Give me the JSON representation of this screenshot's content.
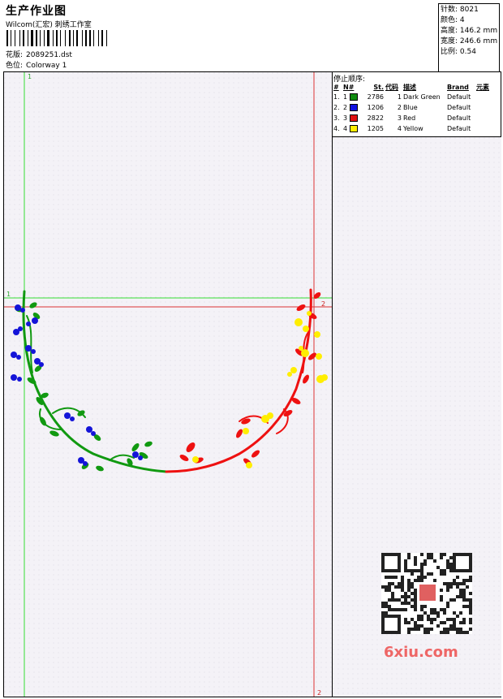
{
  "header": {
    "title": "生产作业图",
    "company": "Wilcom(汇宏) 刺绣工作室",
    "design_label": "花版:",
    "design_value": "2089251.dst",
    "colorway_label": "色位:",
    "colorway_value": "Colorway 1"
  },
  "stats": [
    {
      "label": "针数:",
      "value": "8021"
    },
    {
      "label": "颜色:",
      "value": "4"
    },
    {
      "label": "高度:",
      "value": "146.2 mm"
    },
    {
      "label": "宽度:",
      "value": "246.6 mm"
    },
    {
      "label": "比例:",
      "value": "0.54"
    }
  ],
  "stop_sequence": {
    "title": "停止顺序:",
    "headers": [
      "#",
      "N#",
      "St.",
      "代码",
      "描述",
      "Brand",
      "元素"
    ],
    "rows": [
      {
        "idx": "1.",
        "n": "1",
        "color": "#108c10",
        "st": "2786",
        "code": "1",
        "desc": "Dark Green",
        "brand": "Default"
      },
      {
        "idx": "2.",
        "n": "2",
        "color": "#1010e0",
        "st": "1206",
        "code": "2",
        "desc": "Blue",
        "brand": "Default"
      },
      {
        "idx": "3.",
        "n": "3",
        "color": "#e01010",
        "st": "2822",
        "code": "3",
        "desc": "Red",
        "brand": "Default"
      },
      {
        "idx": "4.",
        "n": "4",
        "color": "#ffee00",
        "st": "1205",
        "code": "4",
        "desc": "Yellow",
        "brand": "Default"
      }
    ]
  },
  "guides": {
    "green_label_v": "1",
    "green_label_h": "1",
    "red_label_h": "2",
    "red_label_v": "2"
  },
  "watermark": {
    "site": "6xiu.com"
  },
  "colors": {
    "green": "#119911",
    "blue": "#1414d8",
    "red": "#ee1111",
    "yellow": "#ffee00",
    "guide_green": "#33dd33",
    "guide_red": "#dd3333",
    "canvas_bg": "#f4f2f7"
  }
}
